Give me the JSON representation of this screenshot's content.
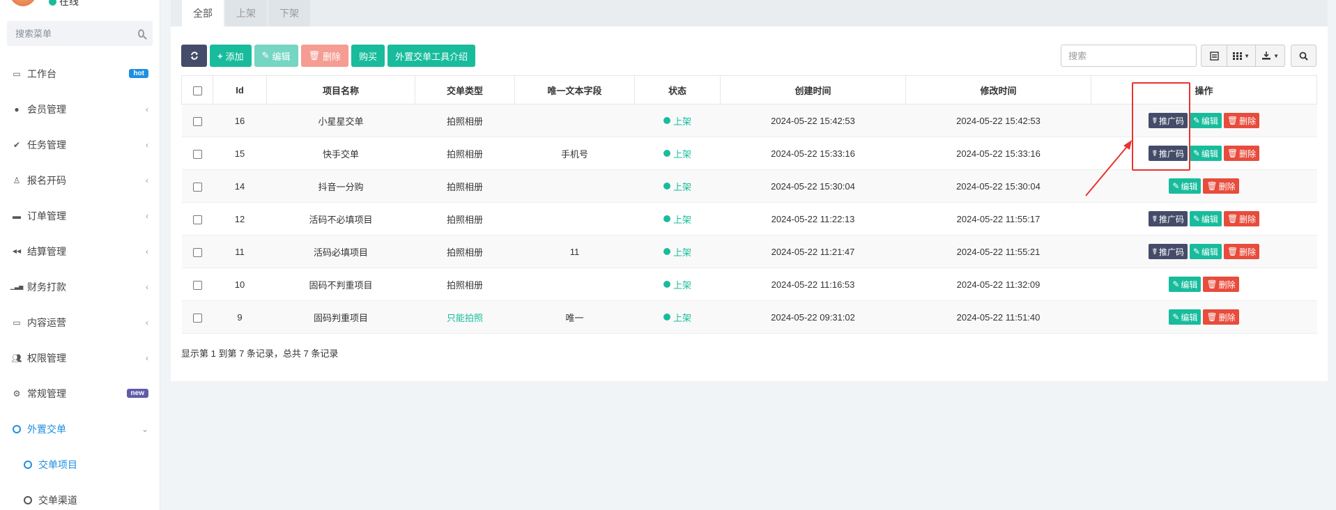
{
  "sidebar": {
    "status_text": "在线",
    "search_placeholder": "搜索菜单",
    "items": [
      {
        "label": "工作台",
        "icon": "monitor-icon",
        "badge": "hot"
      },
      {
        "label": "会员管理",
        "icon": "user-circle-icon"
      },
      {
        "label": "任务管理",
        "icon": "check-icon"
      },
      {
        "label": "报名开码",
        "icon": "person-icon"
      },
      {
        "label": "订单管理",
        "icon": "folder-icon"
      },
      {
        "label": "结算管理",
        "icon": "backward-icon"
      },
      {
        "label": "财务打款",
        "icon": "signal-icon"
      },
      {
        "label": "内容运营",
        "icon": "battery-icon"
      },
      {
        "label": "权限管理",
        "icon": "users-icon"
      },
      {
        "label": "常规管理",
        "icon": "cogs-icon",
        "badge": "new"
      },
      {
        "label": "外置交单",
        "icon": "circle-icon"
      },
      {
        "label": "交单项目",
        "icon": "circle-icon"
      },
      {
        "label": "交单渠道",
        "icon": "circle-icon"
      }
    ]
  },
  "tabs": [
    "全部",
    "上架",
    "下架"
  ],
  "toolbar": {
    "add": "添加",
    "edit": "编辑",
    "delete": "删除",
    "buy": "购买",
    "intro": "外置交单工具介绍"
  },
  "search": {
    "placeholder": "搜索"
  },
  "table": {
    "headers": [
      "Id",
      "项目名称",
      "交单类型",
      "唯一文本字段",
      "状态",
      "创建时间",
      "修改时间",
      "操作"
    ],
    "rows": [
      {
        "id": "16",
        "name": "小星星交单",
        "type": "拍照相册",
        "field": "",
        "status": "上架",
        "created": "2024-05-22 15:42:53",
        "modified": "2024-05-22 15:42:53",
        "promo": true
      },
      {
        "id": "15",
        "name": "快手交单",
        "type": "拍照相册",
        "field": "手机号",
        "status": "上架",
        "created": "2024-05-22 15:33:16",
        "modified": "2024-05-22 15:33:16",
        "promo": true
      },
      {
        "id": "14",
        "name": "抖音一分购",
        "type": "拍照相册",
        "field": "",
        "status": "上架",
        "created": "2024-05-22 15:30:04",
        "modified": "2024-05-22 15:30:04",
        "promo": false
      },
      {
        "id": "12",
        "name": "活码不必填项目",
        "type": "拍照相册",
        "field": "",
        "status": "上架",
        "created": "2024-05-22 11:22:13",
        "modified": "2024-05-22 11:55:17",
        "promo": true
      },
      {
        "id": "11",
        "name": "活码必填项目",
        "type": "拍照相册",
        "field": "11",
        "status": "上架",
        "created": "2024-05-22 11:21:47",
        "modified": "2024-05-22 11:55:21",
        "promo": true
      },
      {
        "id": "10",
        "name": "固码不判重项目",
        "type": "拍照相册",
        "field": "",
        "status": "上架",
        "created": "2024-05-22 11:16:53",
        "modified": "2024-05-22 11:32:09",
        "promo": false
      },
      {
        "id": "9",
        "name": "固码判重项目",
        "type": "只能拍照",
        "field": "唯一",
        "status": "上架",
        "created": "2024-05-22 09:31:02",
        "modified": "2024-05-22 11:51:40",
        "promo": false
      }
    ],
    "op_labels": {
      "promo": "推广码",
      "edit": "编辑",
      "delete": "删除"
    }
  },
  "summary": "显示第 1 到第 7 条记录，总共 7 条记录",
  "colors": {
    "green": "#18bc9c",
    "dark": "#444c69",
    "red": "#e74c3c",
    "blue": "#1e8fe1",
    "highlight": "#e8332e"
  }
}
